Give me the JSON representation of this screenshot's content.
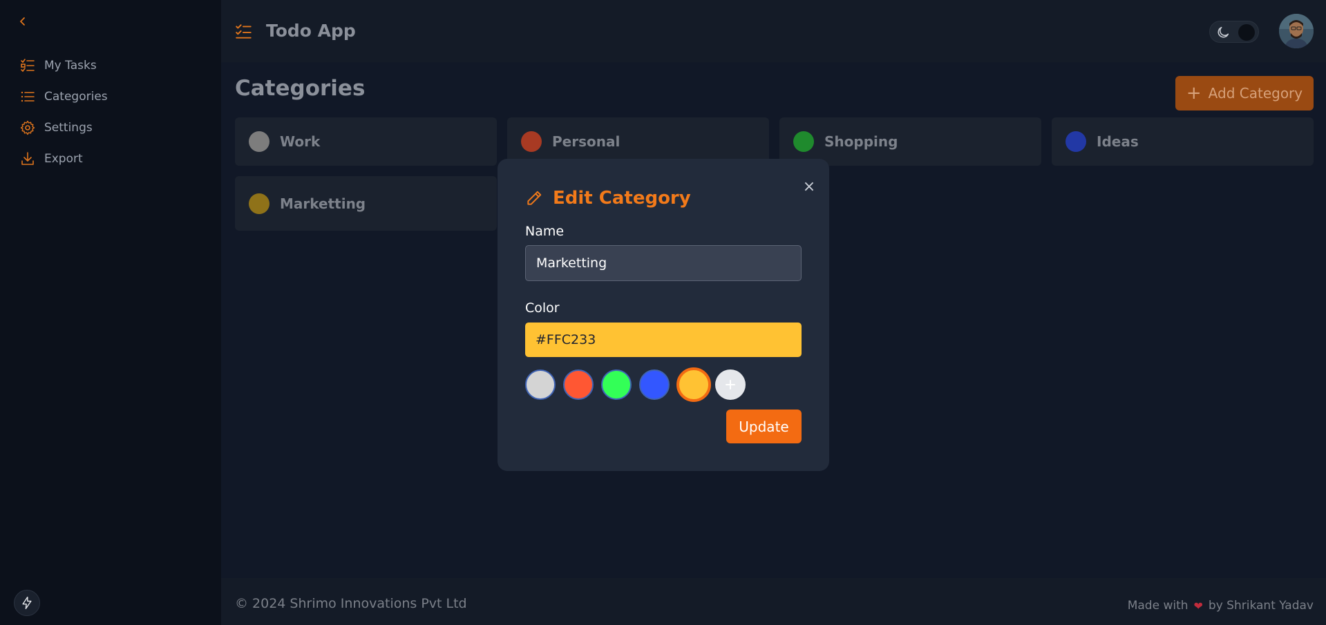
{
  "app": {
    "title": "Todo App"
  },
  "sidebar": {
    "items": [
      {
        "label": "My Tasks",
        "icon": "tasks-list-icon"
      },
      {
        "label": "Categories",
        "icon": "list-icon"
      },
      {
        "label": "Settings",
        "icon": "gear-icon"
      },
      {
        "label": "Export",
        "icon": "download-icon"
      }
    ]
  },
  "page": {
    "title": "Categories",
    "add_button_label": "Add Category"
  },
  "categories": [
    {
      "name": "Work",
      "color": "#7d7d7d"
    },
    {
      "name": "Personal",
      "color": "#a83a23"
    },
    {
      "name": "Shopping",
      "color": "#1f8a2d"
    },
    {
      "name": "Ideas",
      "color": "#2238a5"
    },
    {
      "name": "Marketting",
      "color": "#8f7219"
    }
  ],
  "modal": {
    "title": "Edit Category",
    "name_label": "Name",
    "name_value": "Marketting",
    "color_label": "Color",
    "color_value": "#FFC233",
    "swatches": [
      "#d4d4d4",
      "#ff5733",
      "#33ff57",
      "#3357ff",
      "#ffc233"
    ],
    "selected_swatch": "#ffc233",
    "update_label": "Update"
  },
  "footer": {
    "copyright": "© 2024 Shrimo Innovations Pvt Ltd",
    "made_with": "Made with",
    "author": "by Shrikant Yadav"
  },
  "colors": {
    "accent": "#f36b12"
  }
}
